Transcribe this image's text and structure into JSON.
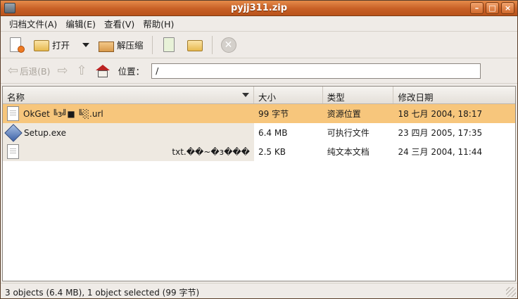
{
  "window": {
    "title": "pyjj311.zip",
    "buttons": {
      "minimize": "–",
      "maximize": "□",
      "close": "×"
    }
  },
  "menubar": {
    "items": [
      {
        "label": "归档文件(A)"
      },
      {
        "label": "编辑(E)"
      },
      {
        "label": "查看(V)"
      },
      {
        "label": "帮助(H)"
      }
    ]
  },
  "toolbar": {
    "open_label": "打开",
    "extract_label": "解压缩",
    "stop_icon": "✕"
  },
  "locationbar": {
    "back_label": "后退(B)",
    "location_label": "位置：",
    "location_value": "/"
  },
  "filelist": {
    "columns": {
      "name": "名称",
      "size": "大小",
      "type": "类型",
      "date": "修改日期"
    },
    "rows": [
      {
        "name": "OkGet ╚з╝■ ╚░.url",
        "size": "99 字节",
        "type": "资源位置",
        "date": "18 七月 2004, 18:17",
        "icon": "file-icon",
        "selected": true
      },
      {
        "name": "Setup.exe",
        "size": "6.4 MB",
        "type": "可执行文件",
        "date": "23 四月 2005, 17:35",
        "icon": "executable-icon",
        "selected": false
      },
      {
        "name": "txt.��~�з���",
        "size": "2.5 KB",
        "type": "纯文本文档",
        "date": "24 三月 2004, 11:44",
        "icon": "file-icon",
        "selected": false
      }
    ]
  },
  "statusbar": {
    "text": "3 objects (6.4 MB), 1 object selected (99 字节)"
  },
  "colors": {
    "titlebar": "#c75f25",
    "selection": "#f7c67c",
    "background": "#efebe7"
  }
}
